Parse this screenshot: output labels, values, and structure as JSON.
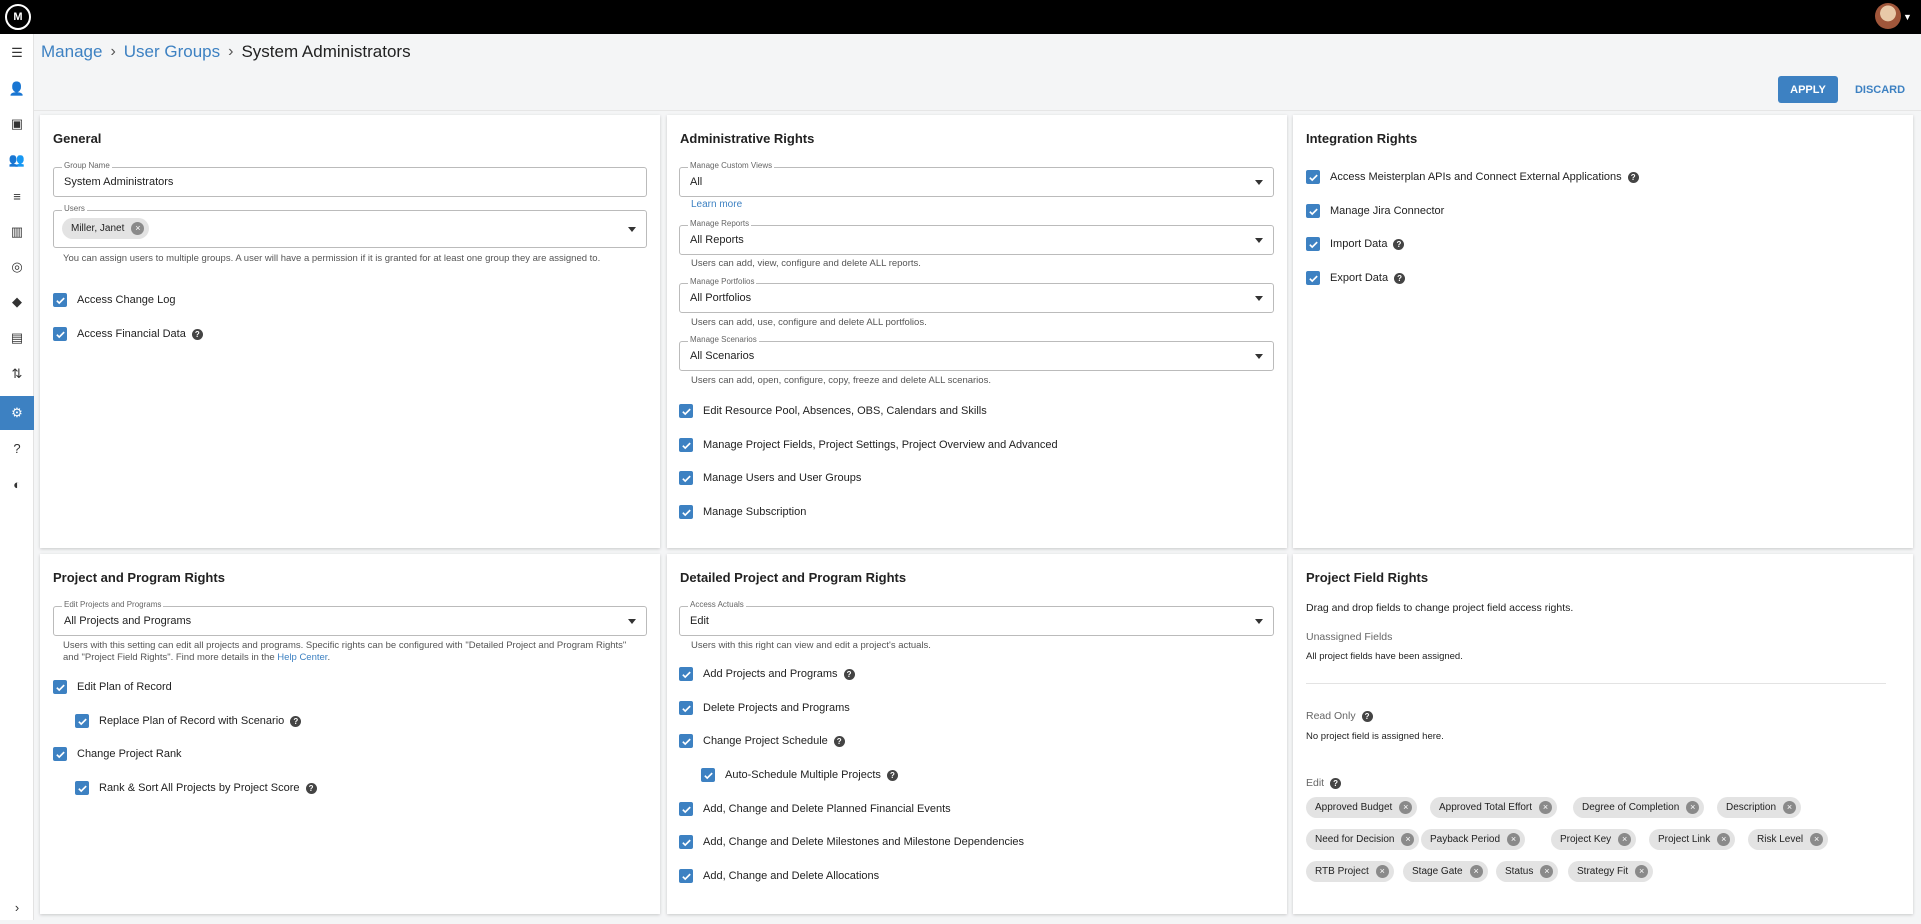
{
  "brand": {
    "logo_text": "M"
  },
  "breadcrumb": {
    "manage": "Manage",
    "user_groups": "User Groups",
    "separator": "›",
    "current": "System Administrators"
  },
  "actions": {
    "apply": "APPLY",
    "discard": "DISCARD"
  },
  "colors": {
    "accent": "#3d81c2",
    "topbar": "#000000",
    "chip_bg": "#e3e3e3"
  },
  "sidebar": {
    "items": [
      {
        "icon": "menu-icon",
        "glyph": "☰"
      },
      {
        "icon": "user-list-icon",
        "glyph": "👤"
      },
      {
        "icon": "contact-card-icon",
        "glyph": "▣"
      },
      {
        "icon": "people-icon",
        "glyph": "👥"
      },
      {
        "icon": "list-icon",
        "glyph": "≡"
      },
      {
        "icon": "columns-icon",
        "glyph": "▥"
      },
      {
        "icon": "target-icon",
        "glyph": "◎"
      },
      {
        "icon": "diamond-icon",
        "glyph": "◆"
      },
      {
        "icon": "document-icon",
        "glyph": "▤"
      },
      {
        "icon": "transfer-icon",
        "glyph": "⇅"
      },
      {
        "icon": "gear-icon",
        "glyph": "⚙"
      },
      {
        "icon": "help-icon",
        "glyph": "?"
      },
      {
        "icon": "compass-icon",
        "glyph": "◐"
      }
    ],
    "expand_glyph": "›"
  },
  "general": {
    "title": "General",
    "group_name_label": "Group Name",
    "group_name_value": "System Administrators",
    "users_label": "Users",
    "user_chip": "Miller, Janet",
    "users_help": "You can assign users to multiple groups. A user will have a permission if it is granted for at least one group they are assigned to.",
    "checkboxes": [
      "Access Change Log",
      "Access Financial Data"
    ]
  },
  "admin": {
    "title": "Administrative Rights",
    "custom_views_label": "Manage Custom Views",
    "custom_views_value": "All",
    "learn_more": "Learn more",
    "reports_label": "Manage Reports",
    "reports_value": "All Reports",
    "reports_help": "Users can add, view, configure and delete ALL reports.",
    "portfolios_label": "Manage Portfolios",
    "portfolios_value": "All Portfolios",
    "portfolios_help": "Users can add, use, configure and delete ALL portfolios.",
    "scenarios_label": "Manage Scenarios",
    "scenarios_value": "All Scenarios",
    "scenarios_help": "Users can add, open, configure, copy, freeze and delete ALL scenarios.",
    "checkboxes": [
      "Edit Resource Pool, Absences, OBS, Calendars and Skills",
      "Manage Project Fields, Project Settings, Project Overview and Advanced",
      "Manage Users and User Groups",
      "Manage Subscription"
    ]
  },
  "integration": {
    "title": "Integration Rights",
    "checkboxes": [
      "Access Meisterplan APIs and Connect External Applications",
      "Manage Jira Connector",
      "Import Data",
      "Export Data"
    ]
  },
  "project": {
    "title": "Project and Program Rights",
    "edit_label": "Edit Projects and Programs",
    "edit_value": "All Projects and Programs",
    "help_text": "Users with this setting can edit all projects and programs. Specific rights can be configured with \"Detailed Project and Program Rights\" and \"Project Field Rights\". Find more details in the ",
    "help_link": "Help Center",
    "help_end": ".",
    "checkboxes": [
      "Edit Plan of Record",
      "Replace Plan of Record with Scenario",
      "Change Project Rank",
      "Rank & Sort All Projects by Project Score"
    ]
  },
  "detailed": {
    "title": "Detailed Project and Program Rights",
    "actuals_label": "Access Actuals",
    "actuals_value": "Edit",
    "actuals_help": "Users with this right can view and edit a project's actuals.",
    "checkboxes": [
      "Add Projects and Programs",
      "Delete Projects and Programs",
      "Change Project Schedule",
      "Auto-Schedule Multiple Projects",
      "Add, Change and Delete Planned Financial Events",
      "Add, Change and Delete Milestones and Milestone Dependencies",
      "Add, Change and Delete Allocations"
    ]
  },
  "field_rights": {
    "title": "Project Field Rights",
    "intro": "Drag and drop fields to change project field access rights.",
    "unassigned_label": "Unassigned Fields",
    "unassigned_text": "All project fields have been assigned.",
    "readonly_label": "Read Only",
    "readonly_text": "No project field is assigned here.",
    "edit_label": "Edit",
    "edit_chips": [
      "Approved Budget",
      "Approved Total Effort",
      "Degree of Completion",
      "Description",
      "Need for Decision",
      "Payback Period",
      "Project Key",
      "Project Link",
      "Risk Level",
      "RTB Project",
      "Stage Gate",
      "Status",
      "Strategy Fit"
    ]
  },
  "glyphs": {
    "help": "?",
    "remove": "×"
  }
}
